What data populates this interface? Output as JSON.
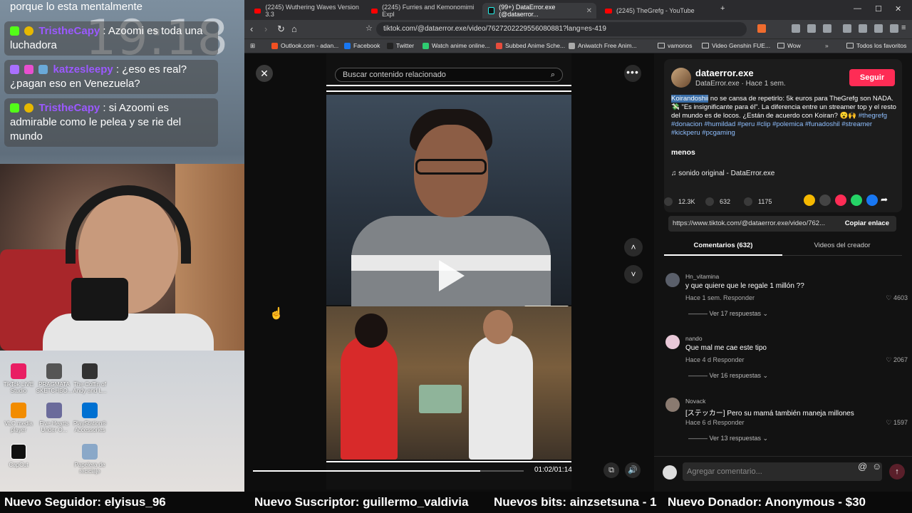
{
  "stream": {
    "clock": "19:18",
    "chat": [
      {
        "user": "",
        "text": "porque lo esta mentalmente",
        "user_color": "#ffffff"
      },
      {
        "user": "TristheCapy",
        "text": ": Azoomi es toda una luchadora",
        "user_color": "#9b59ff"
      },
      {
        "user": "katzesleepy",
        "text": ": ¿eso es real? ¿pagan eso en Venezuela?",
        "user_color": "#9b59ff"
      },
      {
        "user": "TristheCapy",
        "text": ": si Azoomi es admirable como le pelea y se rie del mundo",
        "user_color": "#9b59ff"
      }
    ],
    "desktop_icons": [
      {
        "label": "TikTok LIVE Studio",
        "color": "#e91e63"
      },
      {
        "label": "PRAGMATA SKETCHBO...",
        "color": "#555555"
      },
      {
        "label": "The Coffin of Andy and L...",
        "color": "#333333"
      },
      {
        "label": "VLC media player",
        "color": "#f28c00"
      },
      {
        "label": "Five Hearts Under O...",
        "color": "#6b6b9b"
      },
      {
        "label": "PlayStation® Accessories",
        "color": "#0070d1"
      },
      {
        "label": "CapCut",
        "color": "#111111"
      },
      {
        "label": "Papelera de reciclaje",
        "color": "#8aa8c8"
      }
    ]
  },
  "browser": {
    "tabs": [
      {
        "label": "(2245) Wuthering Waves Version 3.3",
        "kind": "yt"
      },
      {
        "label": "(2245) Furries and Kemonomimi Expl",
        "kind": "yt"
      },
      {
        "label": "(99+) DataError.exe (@dataerror...",
        "kind": "tt"
      },
      {
        "label": "(2245) TheGrefg - YouTube",
        "kind": "yt"
      }
    ],
    "url": "tiktok.com/@dataerror.exe/video/7627202229556080881?lang=es-419",
    "bookmarks": [
      {
        "label": "Outlook.com - adan...",
        "color": "#f25022"
      },
      {
        "label": "Facebook",
        "color": "#1877f2"
      },
      {
        "label": "Twitter",
        "color": "#222222"
      },
      {
        "label": "Watch anime online...",
        "color": "#2ecc71"
      },
      {
        "label": "Subbed Anime Sche...",
        "color": "#e74c3c"
      },
      {
        "label": "Aniwatch Free Anim...",
        "color": "#aaaaaa"
      },
      {
        "label": "vamonos",
        "color": "folder"
      },
      {
        "label": "Video Genshin FUE...",
        "color": "folder"
      },
      {
        "label": "Wow",
        "color": "folder"
      }
    ],
    "bookmarks_all": "Todos los favoritos"
  },
  "video": {
    "search_placeholder": "Buscar contenido relacionado",
    "progress": 0.84,
    "time": "01:02/01:14"
  },
  "post": {
    "username": "dataerror.exe",
    "subline": "DataError.exe · Hace 1 sem.",
    "follow_label": "Seguir",
    "desc_highlight": "Koirandoshii",
    "desc_text": " no se cansa de repetirlo: 5k euros para TheGrefg son NADA. 💸 \"Es insignificante para él\". La diferencia entre un streamer top y el resto del mundo es de locos. ¿Están de acuerdo con Koiran? 😮🙌",
    "hashtags": "#thegrefg #donacion #humildad #peru #clip #polemica #funadoshil #streamer #kickperu #pcgaming",
    "less_label": "menos",
    "sound": "♫  sonido original - DataError.exe",
    "likes": "12.3K",
    "comments": "632",
    "saves": "1175",
    "link": "https://www.tiktok.com/@dataerror.exe/video/762...",
    "copy_label": "Copiar enlace",
    "tab_comments": "Comentarios (632)",
    "tab_videos": "Videos del creador"
  },
  "comments": [
    {
      "name": "Hn_vitamina",
      "text": "y que quiere que le regale 1 millón ??",
      "meta": "Hace 1 sem.   Responder",
      "likes": "4603",
      "replies": "Ver 17 respuestas ⌄"
    },
    {
      "name": "nando",
      "text": "Que mal me cae este tipo",
      "meta": "Hace 4 d   Responder",
      "likes": "2067",
      "replies": "Ver 16 respuestas ⌄"
    },
    {
      "name": "Novack",
      "text": "[ステッカー] Pero su mamá también maneja millones",
      "meta": "Hace 6 d   Responder",
      "likes": "1597",
      "replies": "Ver 13 respuestas ⌄"
    }
  ],
  "add_comment_placeholder": "Agregar comentario...",
  "ticker": {
    "follower": "Nuevo Seguidor: elyisus_96",
    "subscriber": "Nuevo Suscriptor: guillermo_valdivia",
    "bits": "Nuevos bits: ainzsetsuna - 1",
    "donor": "Nuevo Donador: Anonymous - $30"
  }
}
